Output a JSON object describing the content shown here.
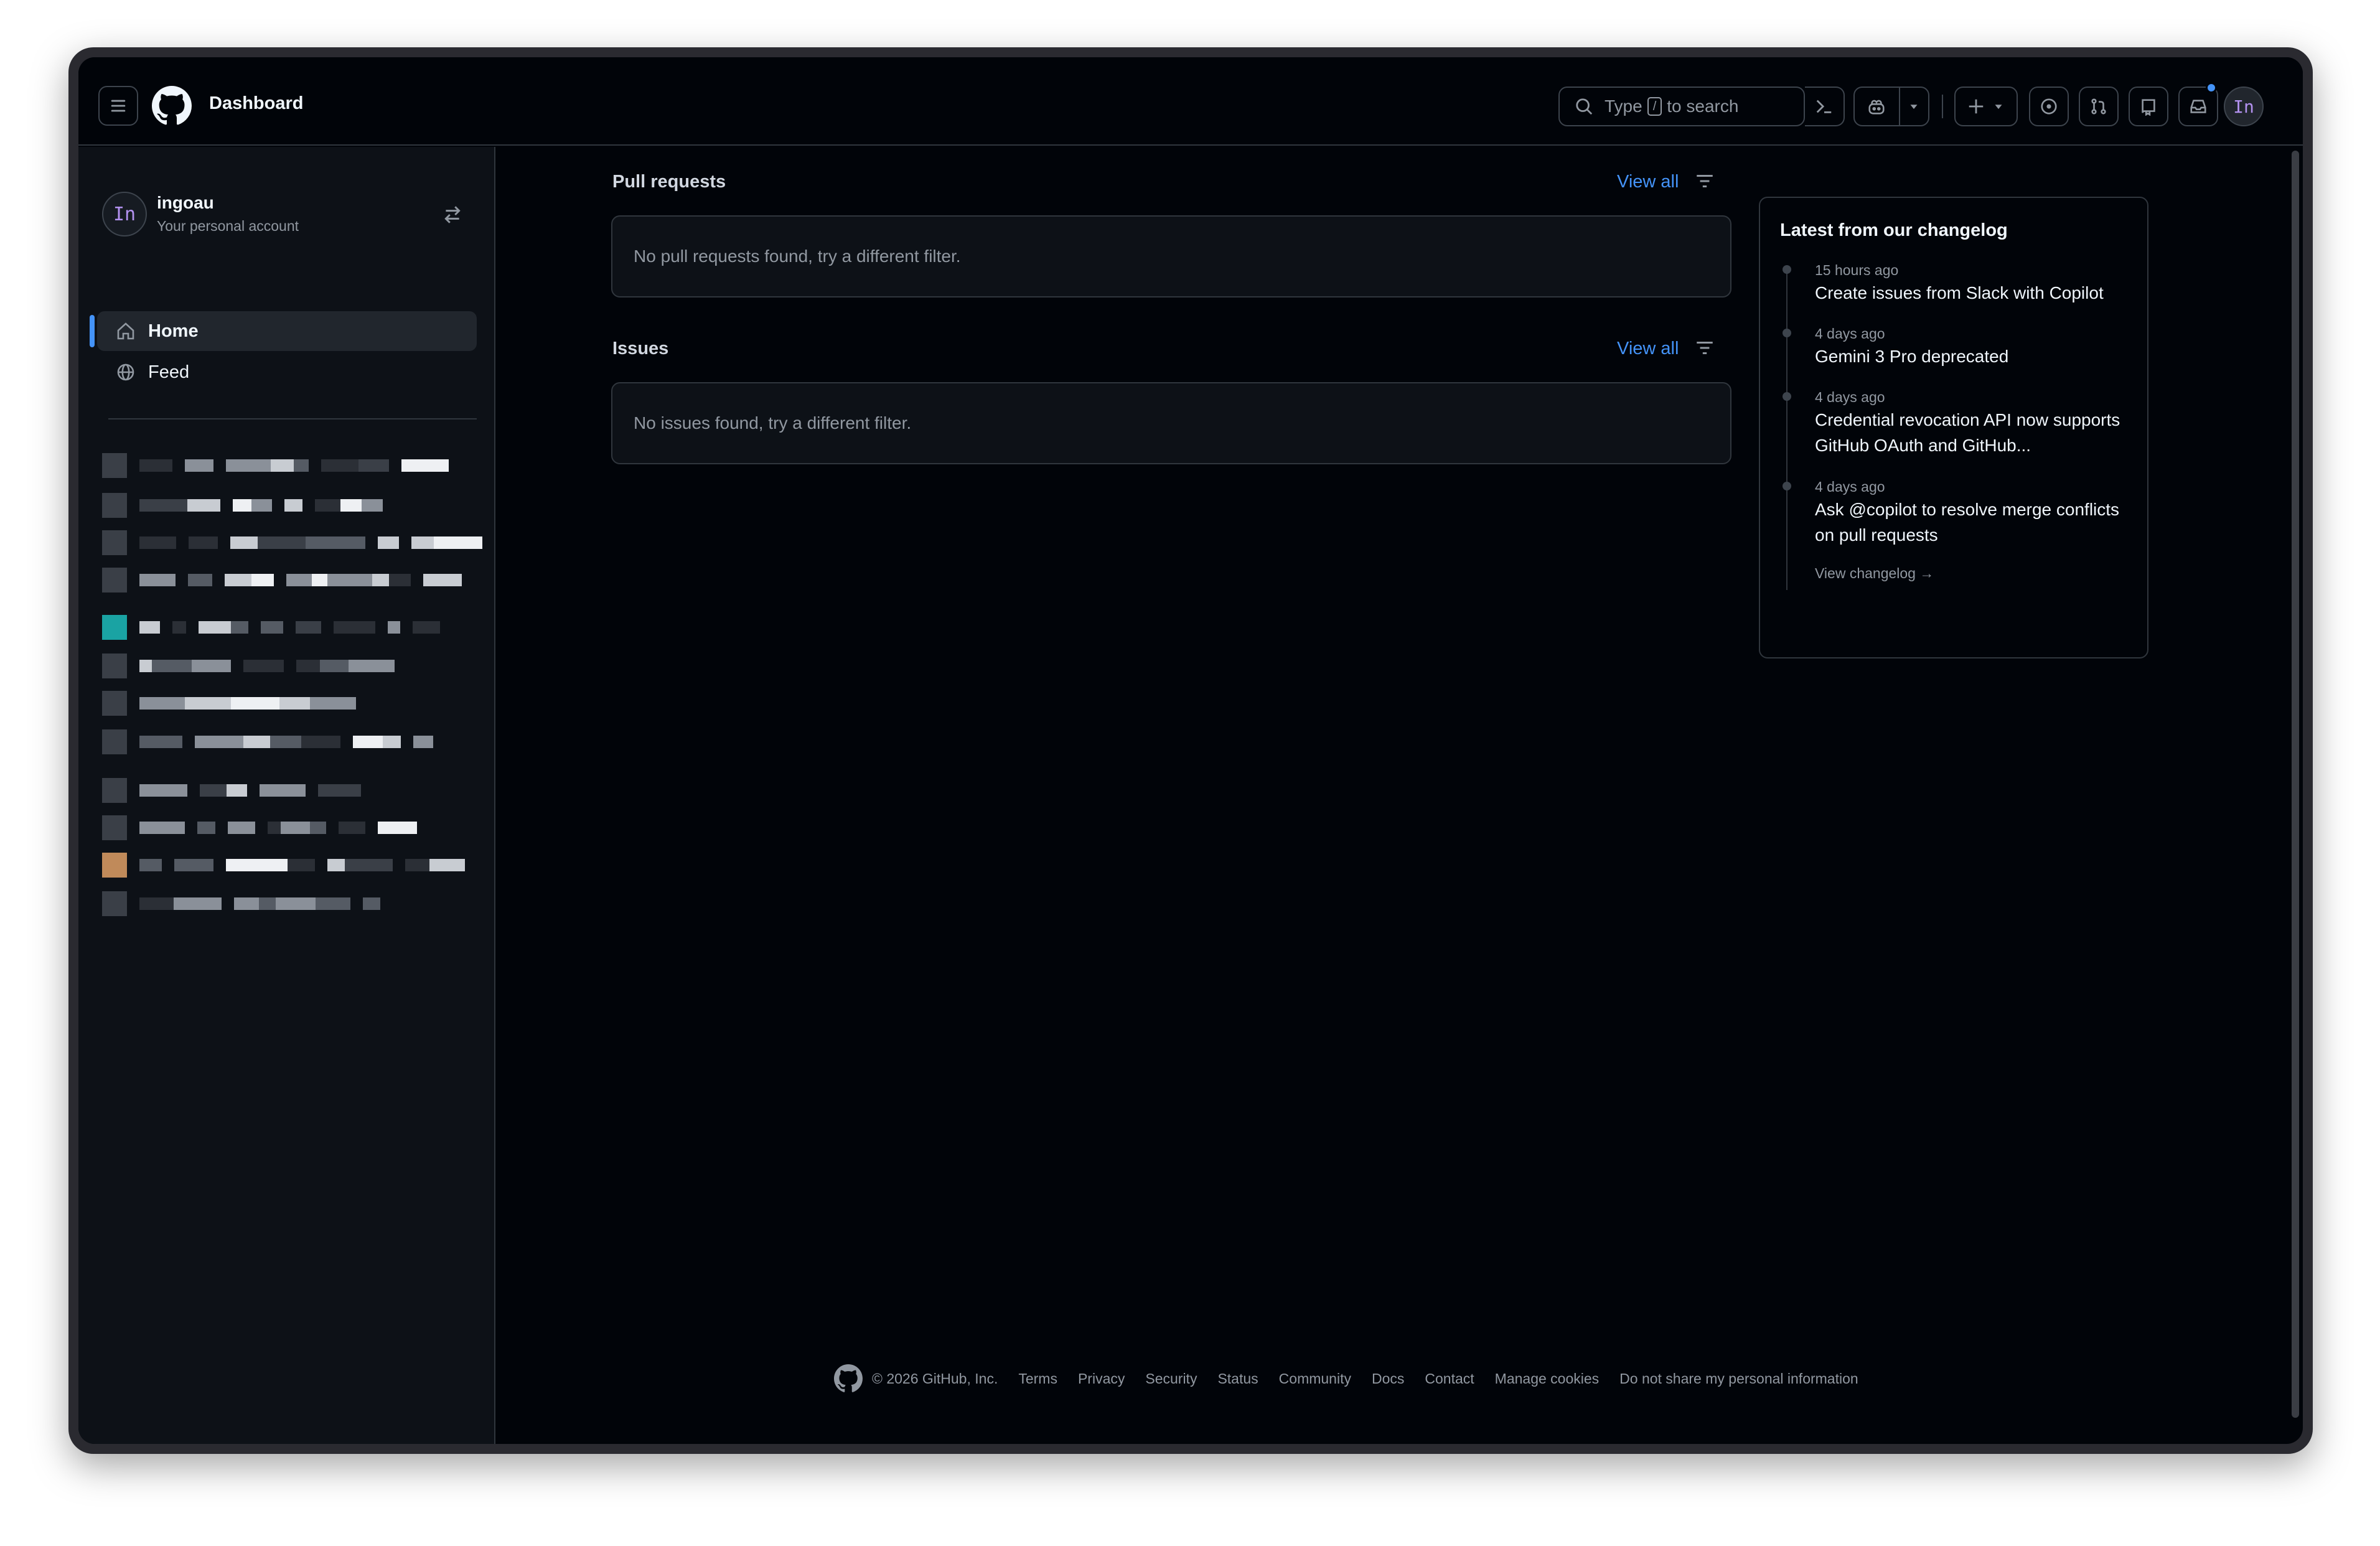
{
  "header": {
    "title": "Dashboard",
    "search": {
      "pre": "Type",
      "key": "/",
      "post": "to search"
    },
    "user_initials": "In"
  },
  "sidebar": {
    "account": {
      "name": "ingoau",
      "subtitle": "Your personal account",
      "initials": "In"
    },
    "nav": [
      {
        "label": "Home",
        "icon": "home-icon",
        "active": true
      },
      {
        "label": "Feed",
        "icon": "globe-icon",
        "active": false
      }
    ]
  },
  "main": {
    "pull_requests": {
      "title": "Pull requests",
      "view_all": "View all",
      "empty": "No pull requests found, try a different filter."
    },
    "issues": {
      "title": "Issues",
      "view_all": "View all",
      "empty": "No issues found, try a different filter."
    }
  },
  "changelog": {
    "title": "Latest from our changelog",
    "items": [
      {
        "time": "15 hours ago",
        "text": "Create issues from Slack with Copilot"
      },
      {
        "time": "4 days ago",
        "text": "Gemini 3 Pro deprecated"
      },
      {
        "time": "4 days ago",
        "text": "Credential revocation API now supports GitHub OAuth and GitHub..."
      },
      {
        "time": "4 days ago",
        "text": "Ask @copilot to resolve merge conflicts on pull requests"
      }
    ],
    "link": "View changelog →"
  },
  "footer": {
    "copyright": "© 2026 GitHub, Inc.",
    "links": [
      "Terms",
      "Privacy",
      "Security",
      "Status",
      "Community",
      "Docs",
      "Contact",
      "Manage cookies",
      "Do not share my personal information"
    ]
  },
  "colors": {
    "background": "#010409",
    "sidebar": "#0d1117",
    "border": "#30363d",
    "link": "#4493f8",
    "muted": "#9198a1",
    "text": "#f0f6fc"
  }
}
